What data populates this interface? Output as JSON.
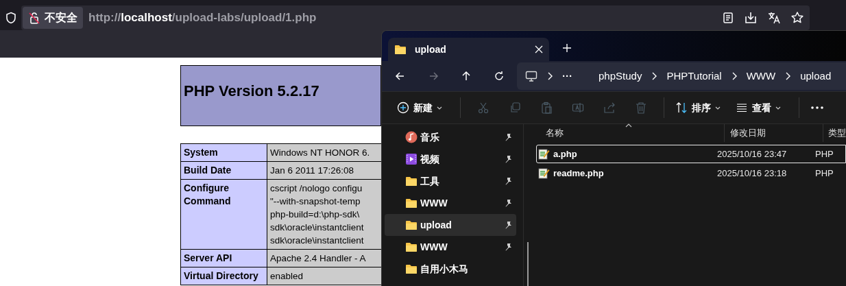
{
  "browser": {
    "address_bar": {
      "security_label": "不安全",
      "url_scheme": "http://",
      "url_host": "localhost",
      "url_path": "/upload-labs/upload/1.php"
    }
  },
  "phpinfo": {
    "title": "PHP Version 5.2.17",
    "rows": [
      {
        "label": "System",
        "value": "Windows NT HONOR 6."
      },
      {
        "label": "Build Date",
        "value": "Jan 6 2011 17:26:08"
      },
      {
        "label": "Configure Command",
        "value": "cscript /nologo configu\n\"--with-snapshot-temp\nphp-build=d:\\php-sdk\\\nsdk\\oracle\\instantclient\nsdk\\oracle\\instantclient"
      },
      {
        "label": "Server API",
        "value": "Apache 2.4 Handler - A"
      },
      {
        "label": "Virtual Directory",
        "value": "enabled"
      }
    ]
  },
  "explorer": {
    "tab": {
      "title": "upload"
    },
    "nav": [
      {
        "kind": "back",
        "disabled": false
      },
      {
        "kind": "forward",
        "disabled": true
      },
      {
        "kind": "up",
        "disabled": false
      },
      {
        "kind": "refresh",
        "disabled": false
      }
    ],
    "breadcrumb": {
      "overflow": "···",
      "parts": [
        "phpStudy",
        "PHPTutorial",
        "WWW",
        "upload"
      ]
    },
    "toolbar": [
      {
        "kind": "new",
        "label": "新建",
        "disabled": false
      },
      {
        "kind": "cut",
        "disabled": true
      },
      {
        "kind": "copy",
        "disabled": true
      },
      {
        "kind": "paste",
        "disabled": true
      },
      {
        "kind": "rename",
        "disabled": true
      },
      {
        "kind": "share",
        "disabled": true
      },
      {
        "kind": "delete",
        "disabled": true
      },
      {
        "kind": "sort",
        "label": "排序",
        "disabled": false
      },
      {
        "kind": "view",
        "label": "查看",
        "disabled": false
      }
    ],
    "sidebar": [
      {
        "kind": "music",
        "label": "音乐",
        "pinned": true,
        "selected": false
      },
      {
        "kind": "video",
        "label": "视频",
        "pinned": true,
        "selected": false
      },
      {
        "kind": "folder",
        "label": "工具",
        "pinned": true,
        "selected": false
      },
      {
        "kind": "folder",
        "label": "WWW",
        "pinned": true,
        "selected": false
      },
      {
        "kind": "folder",
        "label": "upload",
        "pinned": true,
        "selected": true
      },
      {
        "kind": "folder",
        "label": "WWW",
        "pinned": true,
        "selected": false
      },
      {
        "kind": "folder",
        "label": "自用小木马",
        "pinned": false,
        "selected": false
      }
    ],
    "columns": [
      "名称",
      "修改日期",
      "类型"
    ],
    "files": [
      {
        "name": "a.php",
        "modified": "2025/10/16 23:47",
        "type": "PHP",
        "selected": true
      },
      {
        "name": "readme.php",
        "modified": "2025/10/16 23:18",
        "type": "PHP",
        "selected": false
      }
    ]
  }
}
